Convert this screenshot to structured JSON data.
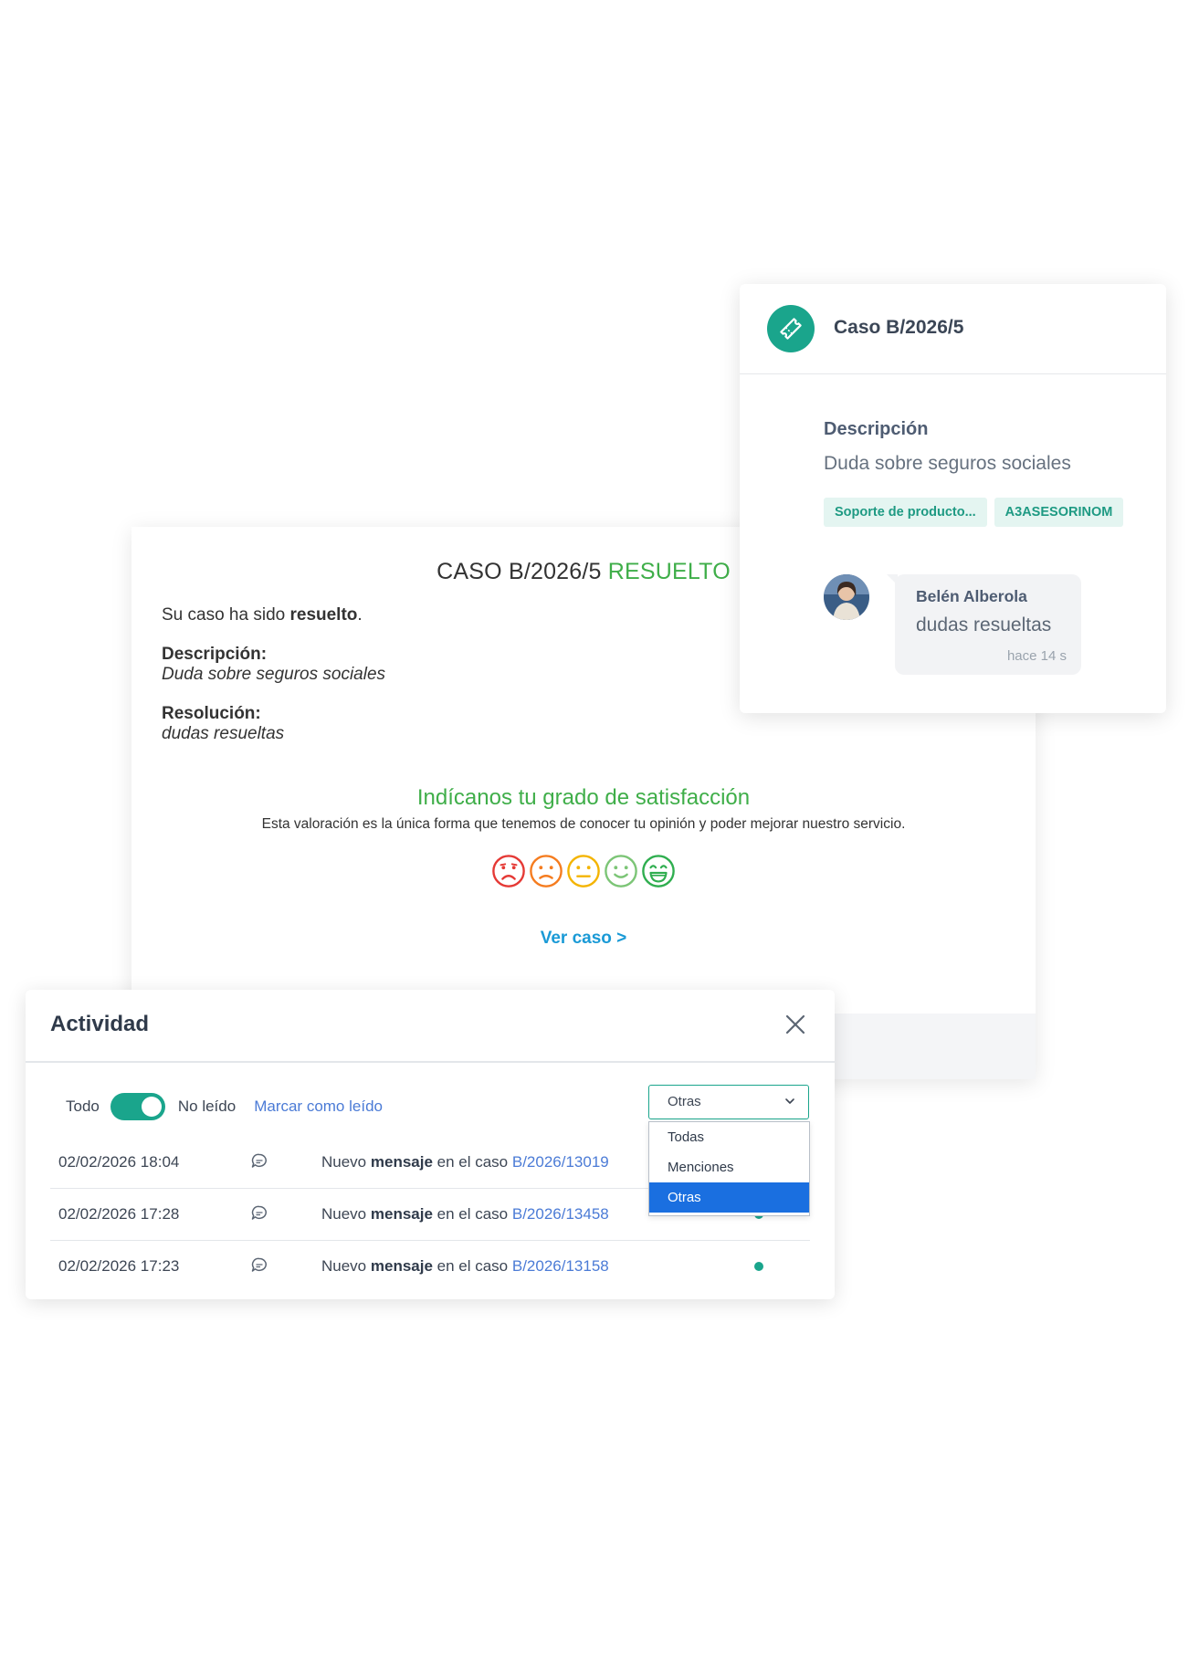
{
  "email": {
    "title_prefix": "CASO B/2026/5",
    "title_status": "RESUELTO",
    "intro_pre": "Su caso ha sido ",
    "intro_bold": "resuelto",
    "intro_post": ".",
    "description_label": "Descripción:",
    "description_value": "Duda sobre seguros sociales",
    "resolution_label": "Resolución:",
    "resolution_value": "dudas resueltas",
    "satisfaction_title": "Indícanos tu grado de satisfacción",
    "satisfaction_subtitle": "Esta valoración es la única forma que tenemos de conocer tu opinión y poder mejorar nuestro servicio.",
    "view_case_link": "Ver caso >",
    "colors": {
      "status_green": "#3fae49",
      "link_blue": "#1a9ad6",
      "face_colors": [
        "#e53935",
        "#f57c1f",
        "#f4b400",
        "#7cc576",
        "#2fae4f"
      ]
    },
    "rating_icons": [
      "very-sad-face-icon",
      "sad-face-icon",
      "neutral-face-icon",
      "smile-face-icon",
      "very-happy-face-icon"
    ]
  },
  "case_card": {
    "icon": "ticket-icon",
    "title": "Caso B/2026/5",
    "description_label": "Descripción",
    "description_value": "Duda sobre seguros sociales",
    "tags": [
      "Soporte de producto...",
      "A3ASESORINOM"
    ],
    "comment": {
      "author": "Belén Alberola",
      "message": "dudas resueltas",
      "time": "hace 14 s"
    },
    "accent": "#1aa58c"
  },
  "activity": {
    "title": "Actividad",
    "filter": {
      "all_label": "Todo",
      "unread_label": "No leído",
      "toggle_on": true,
      "mark_read_label": "Marcar como leído"
    },
    "select": {
      "value": "Otras",
      "options": [
        "Todas",
        "Menciones",
        "Otras"
      ],
      "selected_index": 2
    },
    "rows": [
      {
        "date": "02/02/2026 18:04",
        "prefix": "Nuevo ",
        "bold": "mensaje",
        "middle": " en el caso ",
        "case": "B/2026/13019",
        "unread": true
      },
      {
        "date": "02/02/2026 17:28",
        "prefix": "Nuevo ",
        "bold": "mensaje",
        "middle": " en el caso ",
        "case": "B/2026/13458",
        "unread": true
      },
      {
        "date": "02/02/2026 17:23",
        "prefix": "Nuevo ",
        "bold": "mensaje",
        "middle": " en el caso ",
        "case": "B/2026/13158",
        "unread": true
      }
    ],
    "row_icon": "chat-bubble-icon"
  }
}
